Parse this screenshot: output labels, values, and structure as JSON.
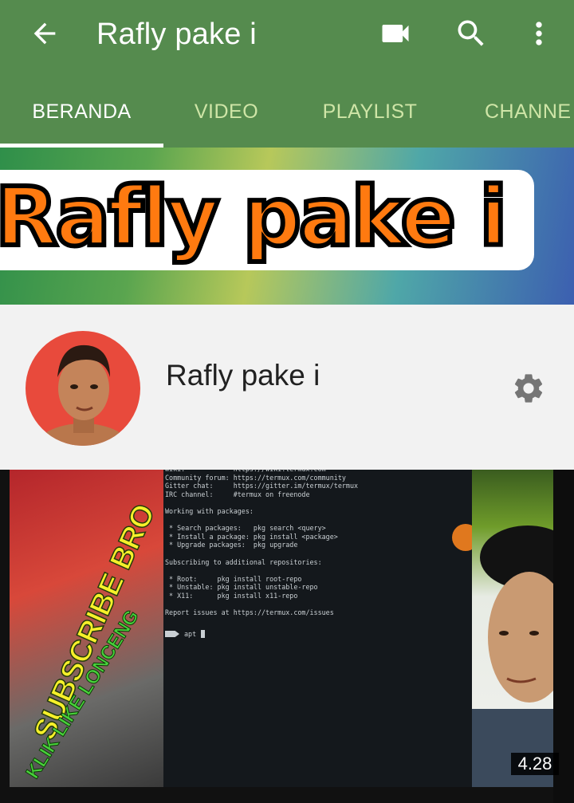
{
  "toolbar": {
    "title": "Rafly pake i",
    "back_icon": "arrow-back-icon",
    "icons": [
      "videocam-icon",
      "search-icon",
      "more-vert-icon"
    ]
  },
  "tabs": [
    {
      "label": "BERANDA",
      "active": true
    },
    {
      "label": "VIDEO",
      "active": false
    },
    {
      "label": "PLAYLIST",
      "active": false
    },
    {
      "label": "CHANNE",
      "active": false
    }
  ],
  "banner": {
    "text": "Rafly pake i"
  },
  "channel": {
    "name": "Rafly pake i",
    "settings_icon": "gear-icon"
  },
  "video": {
    "overlay_text_1": "SUBSCRIBE BRO",
    "overlay_text_2": "KLIK LIKE LONCENG",
    "terminal_lines": "Wiki:            https://wiki.termux.com\nCommunity forum: https://termux.com/community\nGitter chat:     https://gitter.im/termux/termux\nIRC channel:     #termux on freenode\n\nWorking with packages:\n\n * Search packages:   pkg search <query>\n * Install a package: pkg install <package>\n * Upgrade packages:  pkg upgrade\n\nSubscribing to additional repositories:\n\n * Root:     pkg install root-repo\n * Unstable: pkg install unstable-repo\n * X11:      pkg install x11-repo\n\nReport issues at https://termux.com/issues",
    "prompt_text": "apt",
    "duration": "4.28"
  },
  "colors": {
    "appbar": "#558b4e",
    "tab_inactive": "#cfe5a7",
    "channel_bg": "#f2f2f2",
    "avatar_bg": "#e84a3c"
  }
}
